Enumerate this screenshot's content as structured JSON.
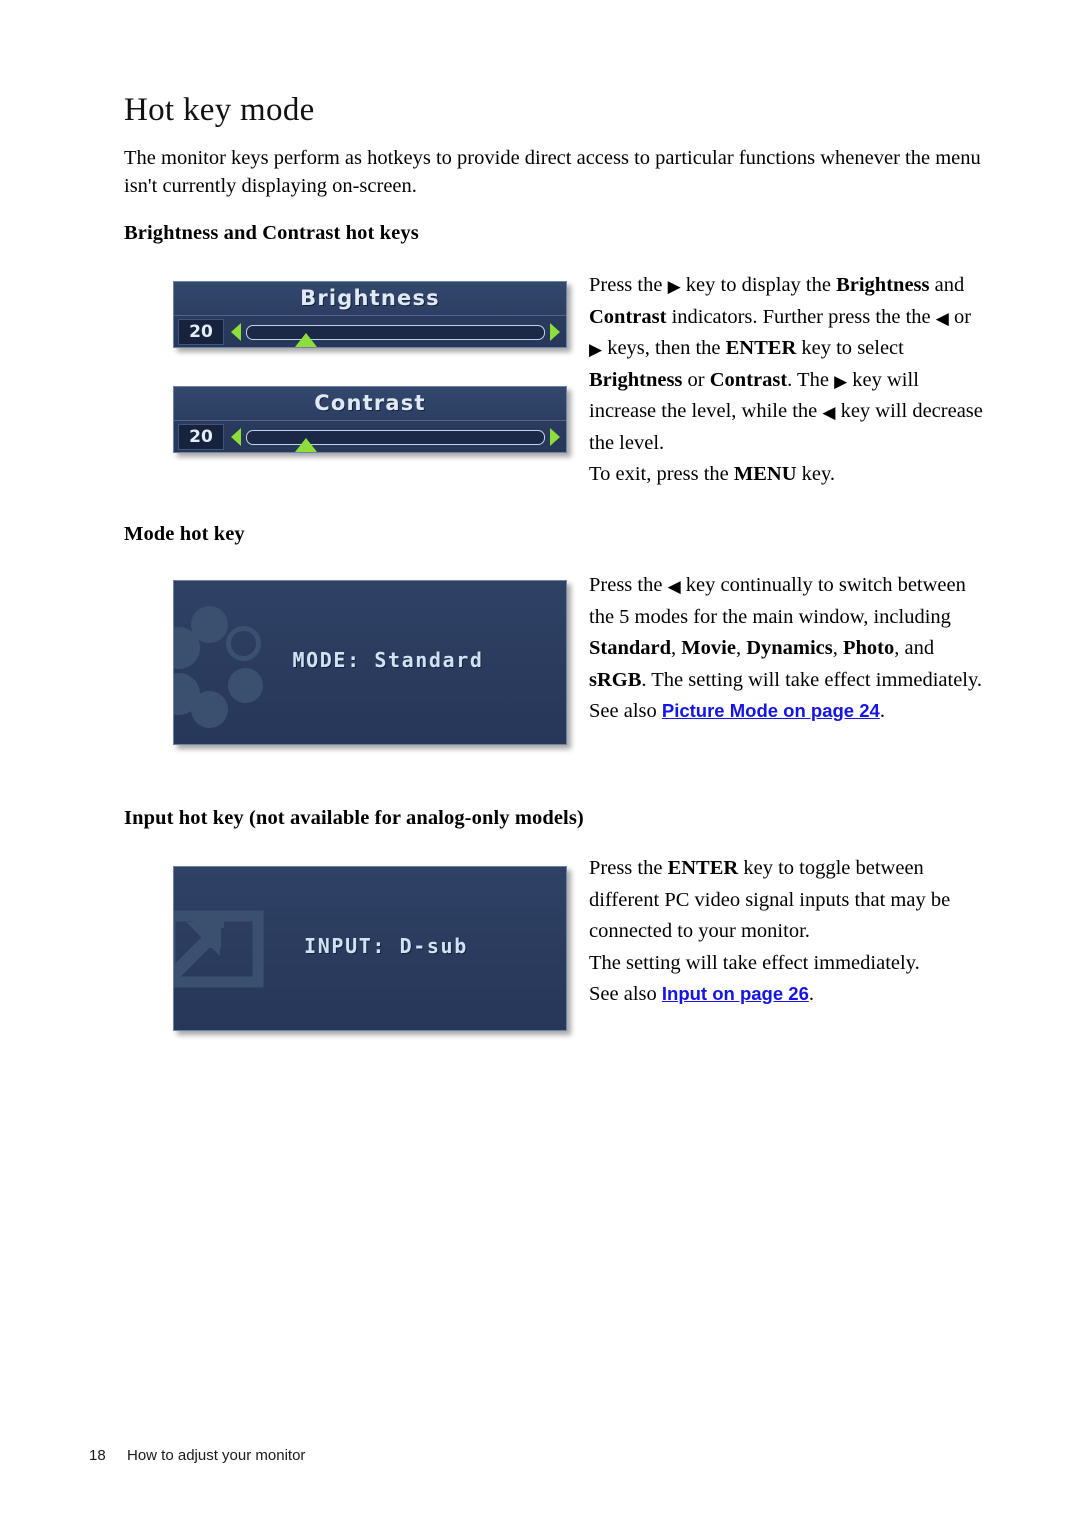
{
  "page": {
    "heading": "Hot key mode",
    "intro": "The monitor keys perform as hotkeys to provide direct access to particular functions whenever the menu isn't currently displaying on-screen.",
    "footer_page_number": "18",
    "footer_title": "How to adjust your monitor"
  },
  "colors": {
    "osd_panel_bg": "#2c3e62",
    "osd_panel_border": "#6f83a8",
    "osd_title_text": "#dfe9f7",
    "osd_value_bg": "#17223d",
    "osd_accent_green": "#8ede3b",
    "osd_track_outline": "#b9d6ee",
    "osd_deco": "#3b506f",
    "link_blue": "#1414e6",
    "page_bg": "#ffffff"
  },
  "sections": {
    "brightness_contrast": {
      "heading": "Brightness and Contrast hot keys",
      "osd": [
        {
          "name": "Brightness",
          "title": "Brightness",
          "value": "20",
          "left_arrow_icon": "triangle-left-icon",
          "right_arrow_icon": "triangle-right-icon",
          "slider_percent": 20,
          "min": 0,
          "max": 100
        },
        {
          "name": "Contrast",
          "title": "Contrast",
          "value": "20",
          "left_arrow_icon": "triangle-left-icon",
          "right_arrow_icon": "triangle-right-icon",
          "slider_percent": 20,
          "min": 0,
          "max": 100
        }
      ],
      "body": {
        "line1_a": "Press the ",
        "line1_icon": "▶",
        "line1_b": " key to display the ",
        "line1_bold1": "Brightness",
        "line2_a": "and ",
        "line2_bold": "Contrast",
        "line2_b": " indicators. Further press the",
        "line3_a": "the ",
        "line3_icon1": "◀",
        "line3_b": " or ",
        "line3_icon2": "▶",
        "line3_c": " keys, then the ",
        "line3_bold": "ENTER",
        "line3_d": " key to",
        "line4_a": "select ",
        "line4_bold1": "Brightness",
        "line4_b": " or ",
        "line4_bold2": "Contrast",
        "line4_c": ". The ",
        "line4_icon": "▶",
        "line4_d": " key",
        "line5_a": "will increase the level, while the ",
        "line5_icon": "◀",
        "line5_b": " key will",
        "line6": "decrease the level.",
        "line7_a": "To exit, press the ",
        "line7_bold": "MENU",
        "line7_b": " key."
      }
    },
    "mode": {
      "heading": "Mode hot key",
      "osd": {
        "text": "MODE: Standard",
        "label": "MODE:",
        "value": "Standard",
        "decoration_icon": "circles-pattern-icon"
      },
      "body": {
        "line1_a": "Press the ",
        "line1_icon": "◀",
        "line1_b": " key continually to switch",
        "line2": "between the 5 modes for the main window,",
        "line3_a": "including ",
        "line3_bold1": "Standard",
        "line3_sep1": ", ",
        "line3_bold2": "Movie",
        "line3_sep2": ", ",
        "line3_bold3": "Dynamics",
        "line3_end": ",",
        "line4_bold1": "Photo",
        "line4_a": ", and ",
        "line4_bold2": "sRGB",
        "line4_b": ". The setting will take effect",
        "line5": "immediately.",
        "see_also_label": "See also ",
        "see_also_link": "Picture Mode on page 24",
        "see_also_period": "."
      }
    },
    "input": {
      "heading": "Input hot key (not available for analog-only models)",
      "osd": {
        "text": "INPUT: D-sub",
        "label": "INPUT:",
        "value": "D-sub",
        "decoration_icon": "arrow-out-of-box-icon"
      },
      "body": {
        "line1_a": "Press the ",
        "line1_bold": "ENTER",
        "line1_b": " key to toggle between",
        "line2": "different PC video signal inputs that may be",
        "line3": "connected to your monitor.",
        "line4": "The setting will take effect immediately.",
        "see_also_label": "See also ",
        "see_also_link": "Input on page 26",
        "see_also_period": "."
      }
    }
  }
}
